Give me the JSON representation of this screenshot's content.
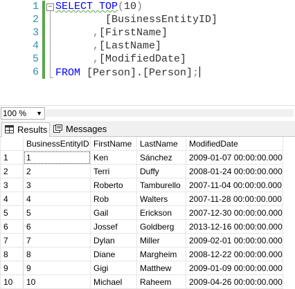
{
  "editor": {
    "line_numbers": [
      "1",
      "2",
      "3",
      "4",
      "5",
      "6"
    ],
    "fold_glyph": "−",
    "line1": {
      "kw": "SELECT TOP",
      "paren_open": "(",
      "num": "10",
      "paren_close": ")"
    },
    "line2": {
      "col": "[BusinessEntityID]"
    },
    "line3": {
      "comma": ",",
      "col": "[FirstName]"
    },
    "line4": {
      "comma": ",",
      "col": "[LastName]"
    },
    "line5": {
      "comma": ",",
      "col": "[ModifiedDate]"
    },
    "line6": {
      "kw": "FROM",
      "obj": "[Person].[Person]",
      "semi": ";"
    }
  },
  "zoom": {
    "value": "100 %"
  },
  "tabs": {
    "results": "Results",
    "messages": "Messages"
  },
  "grid": {
    "columns": [
      "BusinessEntityID",
      "FirstName",
      "LastName",
      "ModifiedDate"
    ],
    "rows": [
      {
        "n": "1",
        "id": "1",
        "first": "Ken",
        "last": "Sánchez",
        "date": "2009-01-07 00:00:00.000"
      },
      {
        "n": "2",
        "id": "2",
        "first": "Terri",
        "last": "Duffy",
        "date": "2008-01-24 00:00:00.000"
      },
      {
        "n": "3",
        "id": "3",
        "first": "Roberto",
        "last": "Tamburello",
        "date": "2007-11-04 00:00:00.000"
      },
      {
        "n": "4",
        "id": "4",
        "first": "Rob",
        "last": "Walters",
        "date": "2007-11-28 00:00:00.000"
      },
      {
        "n": "5",
        "id": "5",
        "first": "Gail",
        "last": "Erickson",
        "date": "2007-12-30 00:00:00.000"
      },
      {
        "n": "6",
        "id": "6",
        "first": "Jossef",
        "last": "Goldberg",
        "date": "2013-12-16 00:00:00.000"
      },
      {
        "n": "7",
        "id": "7",
        "first": "Dylan",
        "last": "Miller",
        "date": "2009-02-01 00:00:00.000"
      },
      {
        "n": "8",
        "id": "8",
        "first": "Diane",
        "last": "Margheim",
        "date": "2008-12-22 00:00:00.000"
      },
      {
        "n": "9",
        "id": "9",
        "first": "Gigi",
        "last": "Matthew",
        "date": "2009-01-09 00:00:00.000"
      },
      {
        "n": "10",
        "id": "10",
        "first": "Michael",
        "last": "Raheem",
        "date": "2009-04-26 00:00:00.000"
      }
    ]
  }
}
